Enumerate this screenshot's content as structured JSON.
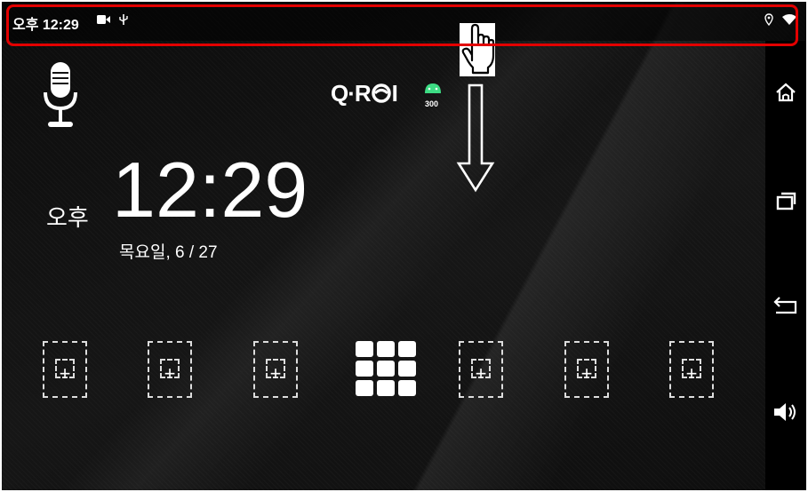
{
  "status_bar": {
    "time": "오후 12:29",
    "left_icons": [
      "video-camera-icon",
      "usb-icon"
    ],
    "right_icons": [
      "location-icon",
      "wifi-icon"
    ]
  },
  "home": {
    "voice_icon": "microphone-icon",
    "logo": {
      "text": "Q·R",
      "text2": "I",
      "sub": "300"
    },
    "clock": {
      "ampm": "오후",
      "time": "12:29",
      "date": "목요일, 6 / 27"
    },
    "dock": {
      "slots": [
        "add-shortcut",
        "add-shortcut",
        "add-shortcut",
        "app-drawer",
        "add-shortcut",
        "add-shortcut",
        "add-shortcut"
      ],
      "add_symbol": "+"
    }
  },
  "nav_bar": {
    "buttons": [
      "home-icon",
      "recent-apps-icon",
      "back-icon",
      "volume-icon"
    ]
  },
  "annotation": {
    "highlight_color": "#e30000",
    "gesture": "swipe-down"
  }
}
